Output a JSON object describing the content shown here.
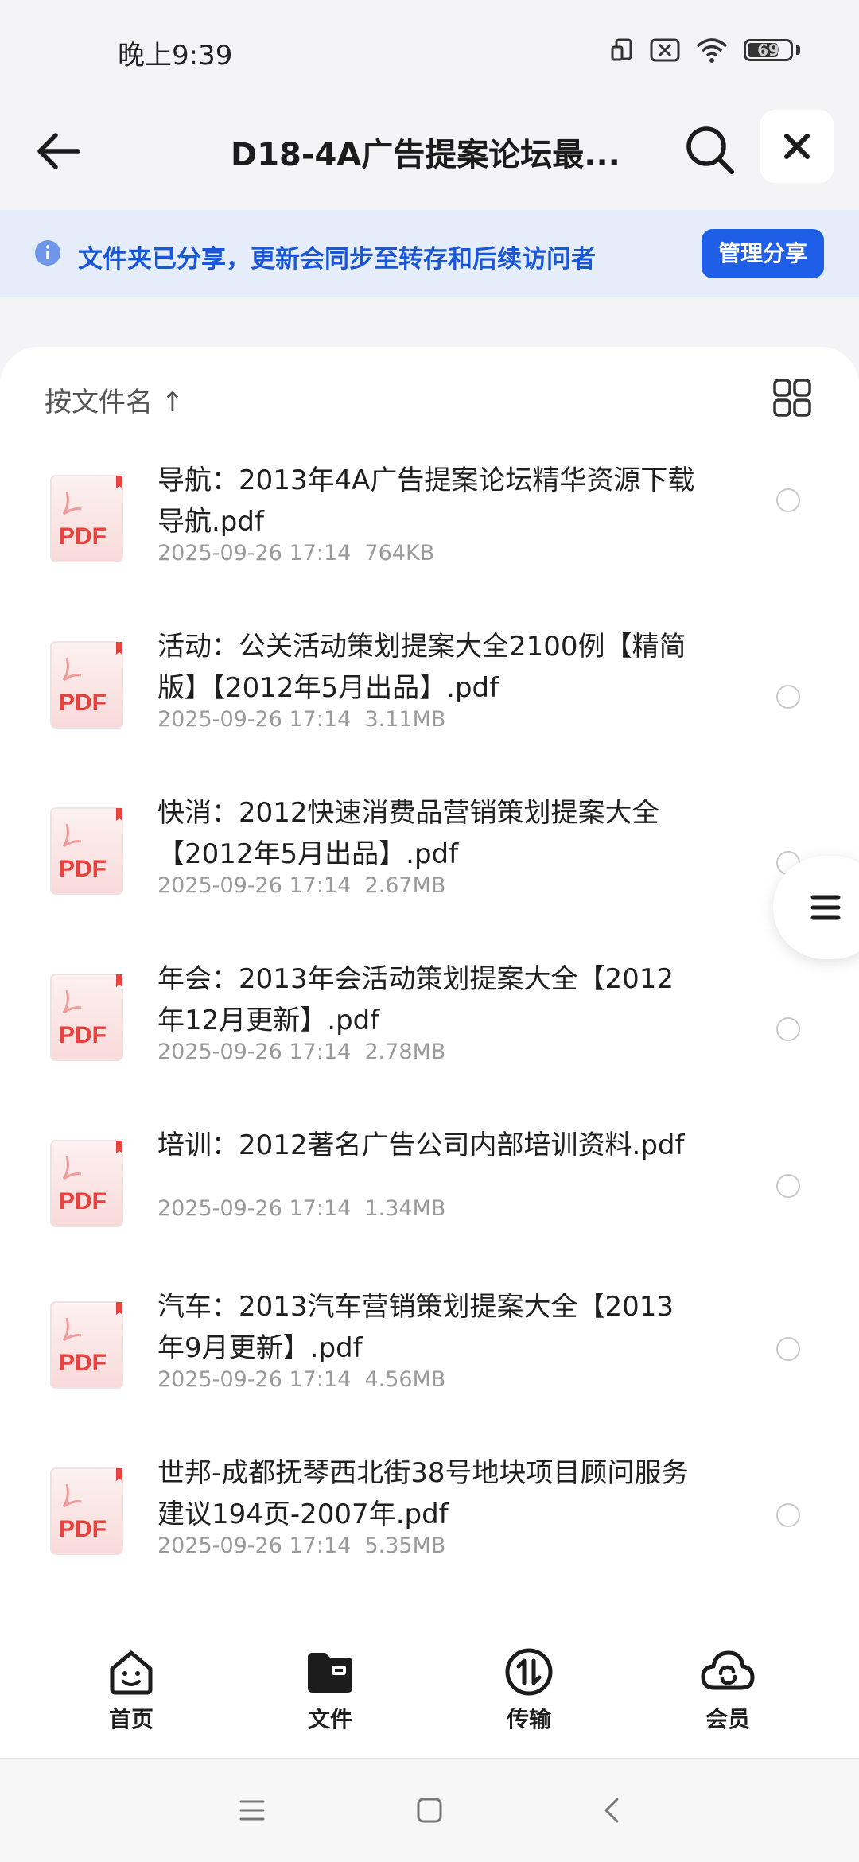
{
  "status_bar": {
    "time": "晚上9:39",
    "battery": "69"
  },
  "header": {
    "title": "D18-4A广告提案论坛最..."
  },
  "banner": {
    "text": "文件夹已分享，更新会同步至转存和后续访问者",
    "button": "管理分享"
  },
  "sort": {
    "label": "按文件名 ↑"
  },
  "files": [
    {
      "name": "导航：2013年4A广告提案论坛精华资源下载导航.pdf",
      "date": "2025-09-26 17:14",
      "size": "764KB",
      "icon": "PDF"
    },
    {
      "name": "活动：公关活动策划提案大全2100例【精简版】【2012年5月出品】.pdf",
      "date": "2025-09-26 17:14",
      "size": "3.11MB",
      "icon": "PDF"
    },
    {
      "name": "快消：2012快速消费品营销策划提案大全【2012年5月出品】.pdf",
      "date": "2025-09-26 17:14",
      "size": "2.67MB",
      "icon": "PDF"
    },
    {
      "name": "年会：2013年会活动策划提案大全【2012年12月更新】.pdf",
      "date": "2025-09-26 17:14",
      "size": "2.78MB",
      "icon": "PDF"
    },
    {
      "name": "培训：2012著名广告公司内部培训资料.pdf",
      "date": "2025-09-26 17:14",
      "size": "1.34MB",
      "icon": "PDF"
    },
    {
      "name": "汽车：2013汽车营销策划提案大全【2013年9月更新】.pdf",
      "date": "2025-09-26 17:14",
      "size": "4.56MB",
      "icon": "PDF"
    },
    {
      "name": "世邦-成都抚琴西北街38号地块项目顾问服务建议194页-2007年.pdf",
      "date": "2025-09-26 17:14",
      "size": "5.35MB",
      "icon": "PDF"
    }
  ],
  "bottom_nav": [
    {
      "label": "首页",
      "icon": "home-smile-icon"
    },
    {
      "label": "文件",
      "icon": "folder-icon"
    },
    {
      "label": "传输",
      "icon": "transfer-icon"
    },
    {
      "label": "会员",
      "icon": "member-cloud-icon"
    }
  ],
  "colors": {
    "accent": "#1f5fe8",
    "banner_bg": "#e6edfa",
    "pdf_red": "#e8423f"
  }
}
